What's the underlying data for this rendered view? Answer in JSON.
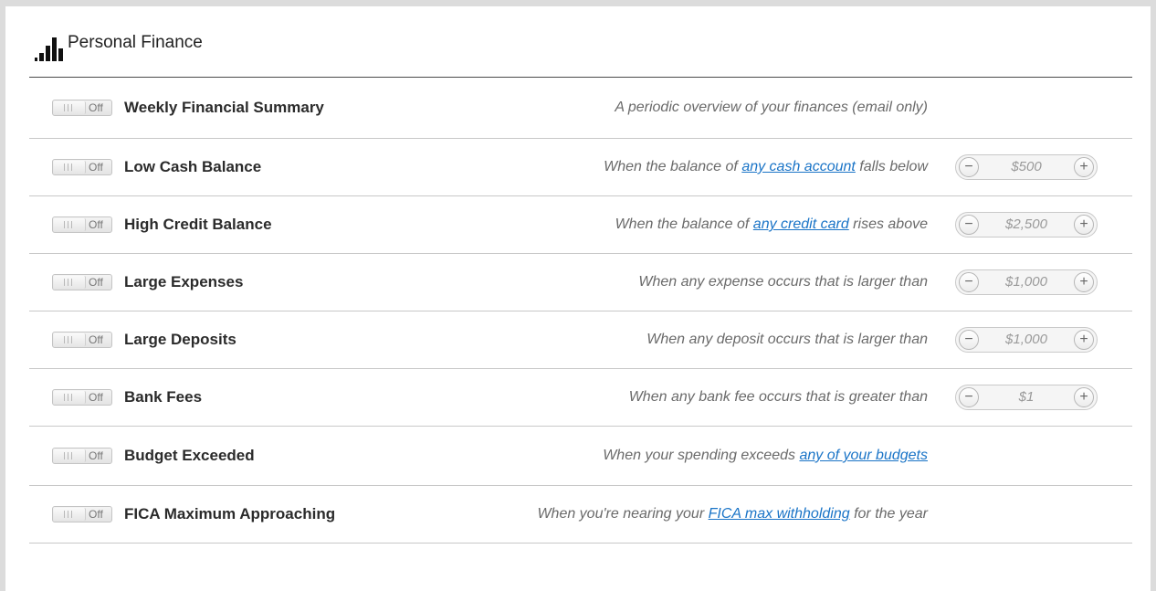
{
  "section": {
    "title": "Personal Finance",
    "icon": "bar-chart-icon"
  },
  "toggle_off_label": "Off",
  "alerts": [
    {
      "name": "Weekly Financial Summary",
      "desc_before": "A periodic overview of your finances (email only)",
      "link": "",
      "desc_after": "",
      "threshold": null
    },
    {
      "name": "Low Cash Balance",
      "desc_before": "When the balance of ",
      "link": "any cash account",
      "desc_after": " falls below",
      "threshold": "$500"
    },
    {
      "name": "High Credit Balance",
      "desc_before": "When the balance of ",
      "link": "any credit card",
      "desc_after": " rises above",
      "threshold": "$2,500"
    },
    {
      "name": "Large Expenses",
      "desc_before": "When any expense occurs that is larger than",
      "link": "",
      "desc_after": "",
      "threshold": "$1,000"
    },
    {
      "name": "Large Deposits",
      "desc_before": "When any deposit occurs that is larger than",
      "link": "",
      "desc_after": "",
      "threshold": "$1,000"
    },
    {
      "name": "Bank Fees",
      "desc_before": "When any bank fee occurs that is greater than",
      "link": "",
      "desc_after": "",
      "threshold": "$1"
    },
    {
      "name": "Budget Exceeded",
      "desc_before": "When your spending exceeds ",
      "link": "any of your budgets",
      "desc_after": "",
      "threshold": null
    },
    {
      "name": "FICA Maximum Approaching",
      "desc_before": "When you're nearing your ",
      "link": "FICA max withholding",
      "desc_after": " for the year",
      "threshold": null
    }
  ],
  "stepper": {
    "minus_symbol": "−",
    "plus_symbol": "+"
  },
  "colors": {
    "link": "#1a74c7",
    "panel_bg": "#ffffff",
    "page_bg": "#dcdcdc"
  }
}
